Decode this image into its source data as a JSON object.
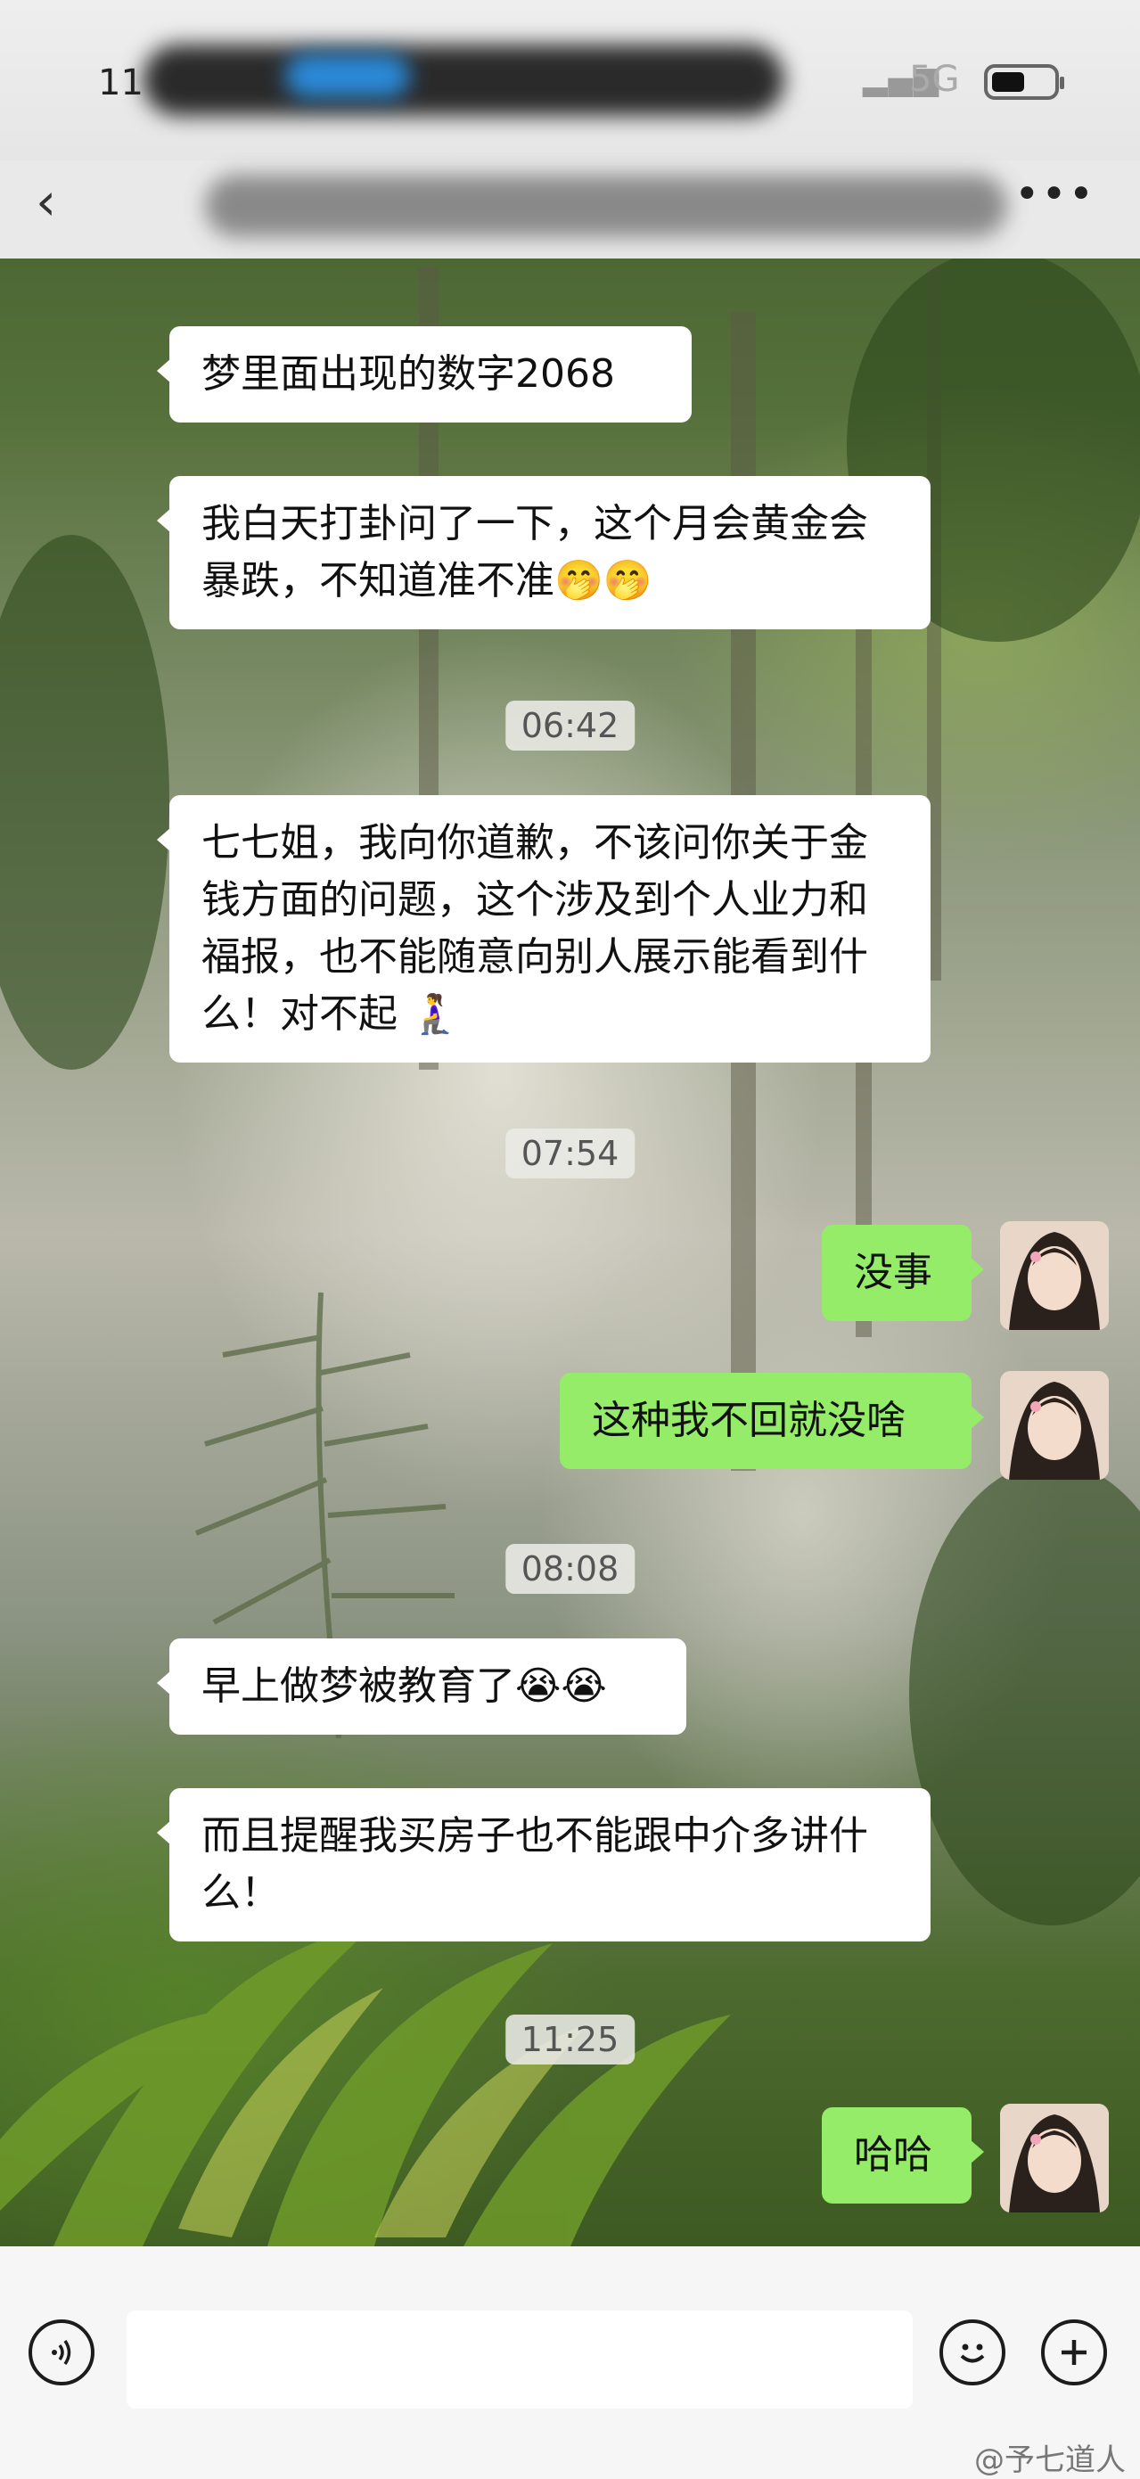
{
  "status_bar": {
    "time": "11",
    "network": "5G"
  },
  "nav": {
    "back_label": "‹",
    "more_label": "•••"
  },
  "messages": [
    {
      "side": "left",
      "text": "梦里面出现的数字2068"
    },
    {
      "side": "left",
      "text": "我白天打卦问了一下，这个月会黄金会暴跌，不知道准不准🤭🤭"
    },
    {
      "timestamp": "06:42"
    },
    {
      "side": "left",
      "text": "七七姐，我向你道歉，不该问你关于金钱方面的问题，这个涉及到个人业力和福报，也不能随意向别人展示能看到什么！对不起 🧎‍♀️"
    },
    {
      "timestamp": "07:54"
    },
    {
      "side": "right",
      "text": "没事"
    },
    {
      "side": "right",
      "text": "这种我不回就没啥"
    },
    {
      "timestamp": "08:08"
    },
    {
      "side": "left",
      "text": "早上做梦被教育了😭😭"
    },
    {
      "side": "left",
      "text": "而且提醒我买房子也不能跟中介多讲什么！"
    },
    {
      "timestamp": "11:25"
    },
    {
      "side": "right",
      "text": "哈哈"
    }
  ],
  "input": {
    "placeholder": ""
  },
  "watermark": "@予七道人",
  "colors": {
    "self_bubble": "#95ec69",
    "other_bubble": "#ffffff",
    "timestamp_bg": "#ebebe6"
  },
  "icons": [
    "voice-icon",
    "emoji-icon",
    "plus-icon"
  ]
}
